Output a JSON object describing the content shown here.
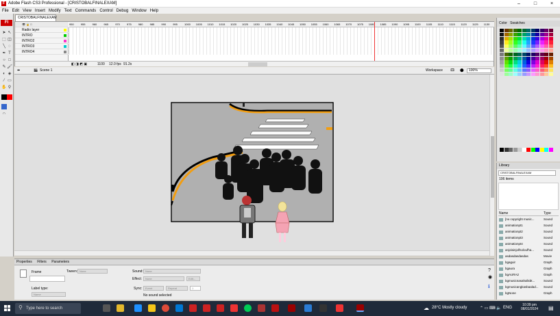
{
  "window": {
    "title": "Adobe Flash CS3 Professional - [CRISTOBALFINALEXAM]",
    "minimize": "–",
    "maximize": "□",
    "close": "×"
  },
  "menu": [
    "File",
    "Edit",
    "View",
    "Insert",
    "Modify",
    "Text",
    "Commands",
    "Control",
    "Debug",
    "Window",
    "Help"
  ],
  "tools_logo": "Fl",
  "document_tab": "CRISTOBALFINALEXAM",
  "timeline": {
    "layers": [
      {
        "name": "Radio layer",
        "color": "#ff0"
      },
      {
        "name": "INTRO",
        "color": "#0c0"
      },
      {
        "name": "INTRO2",
        "color": "#f3c"
      },
      {
        "name": "INTRO3",
        "color": "#0cc"
      },
      {
        "name": "INTRO4",
        "color": "#888"
      }
    ],
    "ruler": [
      "950",
      "955",
      "960",
      "965",
      "970",
      "975",
      "980",
      "985",
      "990",
      "995",
      "1000",
      "1005",
      "1010",
      "1015",
      "1020",
      "1025",
      "1030",
      "1035",
      "1040",
      "1045",
      "1050",
      "1055",
      "1060",
      "1065",
      "1070",
      "1075",
      "1080",
      "1085",
      "1090",
      "1095",
      "1100",
      "1105",
      "1110",
      "1115",
      "1120",
      "1125",
      "1130",
      "1135"
    ],
    "current_frame": "1100",
    "fps": "12.0 fps",
    "time": "91.2s"
  },
  "editbar": {
    "scene": "Scene 1",
    "workspace": "Workspace",
    "zoom": "100%"
  },
  "properties": {
    "tabs": [
      "Properties",
      "Filters",
      "Parameters"
    ],
    "frame_label": "Frame",
    "tween_label": "Tween:",
    "tween_value": "None",
    "label_type": "Label type:",
    "label_type_value": "Name",
    "sound_label": "Sound:",
    "sound_value": "None",
    "effect_label": "Effect:",
    "effect_value": "None",
    "edit_button": "Edit...",
    "sync_label": "Sync:",
    "sync_value": "Event",
    "repeat_value": "Repeat",
    "repeat_count": "1",
    "no_sound": "No sound selected"
  },
  "color_panel": {
    "tabs": [
      "Color",
      "Swatches"
    ]
  },
  "library": {
    "tab": "Library",
    "file": "CRISTOBALFINALEXAM",
    "count": "106 items",
    "header_name": "Name",
    "header_type": "Type",
    "items": [
      {
        "name": "[no copyright music...",
        "type": "Sound"
      },
      {
        "name": "animationpt1",
        "type": "Sound"
      },
      {
        "name": "animationpt2",
        "type": "Sound"
      },
      {
        "name": "animationpt3",
        "type": "Sound"
      },
      {
        "name": "animationpt4",
        "type": "Sound"
      },
      {
        "name": "anjolainjolfsoloufha...",
        "type": "Sound"
      },
      {
        "name": "asdasdasdasdas",
        "type": "Movie"
      },
      {
        "name": "bgaguir",
        "type": "Graph"
      },
      {
        "name": "bgaura",
        "type": "Graph"
      },
      {
        "name": "bgAURA2",
        "type": "Graph"
      },
      {
        "name": "bgmusicnasahallxbt...",
        "type": "Sound"
      },
      {
        "name": "bgmusicangkasbaalad...",
        "type": "Sound"
      },
      {
        "name": "bgNone",
        "type": "Graph"
      }
    ]
  },
  "taskbar": {
    "search_placeholder": "Type here to search",
    "weather": "28°C  Mostly cloudy",
    "lang": "ENG",
    "time": "10:39 pm",
    "date": "08/01/2024"
  }
}
